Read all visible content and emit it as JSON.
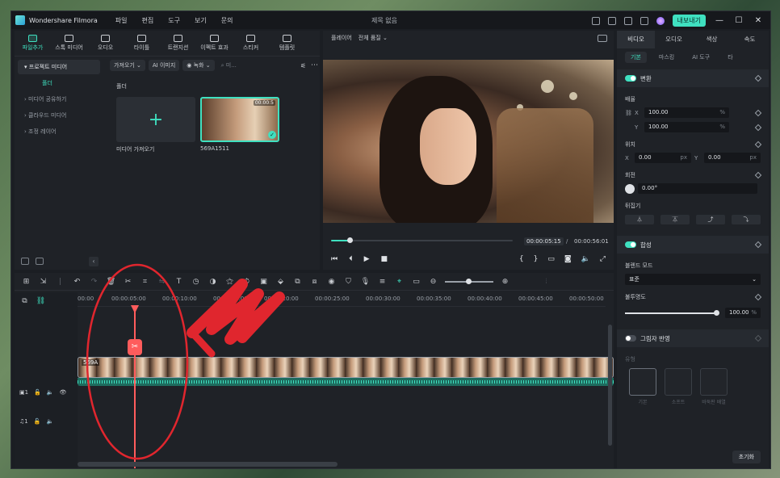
{
  "titlebar": {
    "app_name": "Wondershare Filmora",
    "menu": [
      "파일",
      "편집",
      "도구",
      "보기",
      "문의"
    ],
    "project_title": "제목 없음",
    "export_label": "내보내기"
  },
  "media_panel": {
    "tabs": [
      {
        "label": "파일추가",
        "icon": "import-icon"
      },
      {
        "label": "스톡 미디어",
        "icon": "stock-icon"
      },
      {
        "label": "오디오",
        "icon": "music-icon"
      },
      {
        "label": "타이틀",
        "icon": "text-icon"
      },
      {
        "label": "트랜지션",
        "icon": "transition-icon"
      },
      {
        "label": "이펙트 효과",
        "icon": "effects-icon"
      },
      {
        "label": "스티커",
        "icon": "sticker-icon"
      },
      {
        "label": "템플릿",
        "icon": "template-icon"
      }
    ],
    "sidebar": {
      "project_media": "프로젝트 미디어",
      "folder": "폴더",
      "items": [
        "미디어 공유하기",
        "클라우드 미디어",
        "조정 레이어"
      ]
    },
    "toolbar": {
      "import": "가져오기",
      "ai_image": "AI 이미지",
      "record": "녹화",
      "search": "미..."
    },
    "folder_label": "폴더",
    "import_card_label": "미디어 가져오기",
    "clip": {
      "name": "569A1511",
      "duration": "00:00:5"
    }
  },
  "player": {
    "label": "플레이어",
    "quality": "전체 품질",
    "current_time": "00:00:05:15",
    "separator": "/",
    "total_time": "00:00:56:01",
    "progress": 0.1
  },
  "properties": {
    "tabs": [
      "비디오",
      "오디오",
      "색상",
      "속도"
    ],
    "subtabs": [
      "기본",
      "마스킹",
      "AI 도구",
      "타"
    ],
    "transform": {
      "title": "변환",
      "scale_label": "배율",
      "scale_x": "100.00",
      "scale_y": "100.00",
      "percent": "%",
      "position_label": "위치",
      "pos_x": "0.00",
      "pos_y": "0.00",
      "px": "px",
      "rotation_label": "회전",
      "rotation": "0.00°",
      "flip_label": "뒤집기",
      "x_axis": "X",
      "y_axis": "Y"
    },
    "composite": {
      "title": "합성",
      "blend_label": "블렌드 모드",
      "blend_value": "표준",
      "opacity_label": "불투명도",
      "opacity_value": "100.00",
      "percent": "%"
    },
    "shadow": {
      "title": "그림자 반영",
      "type_label": "유형",
      "types": [
        "기본",
        "소프트",
        "바둑판 배열"
      ]
    },
    "reset_label": "초기화"
  },
  "timeline": {
    "ruler": [
      "00:00",
      "00:00:05:00",
      "00:00:10:00",
      "00:00:15:00",
      "00:00:20:00",
      "00:00:25:00",
      "00:00:30:00",
      "00:00:35:00",
      "00:00:40:00",
      "00:00:45:00",
      "00:00:50:00"
    ],
    "video_track": "1",
    "audio_track": "1",
    "clip_name": "569A"
  },
  "colors": {
    "accent": "#3fe0c0",
    "playhead": "#ff5c5c",
    "annotation": "#e0262e"
  }
}
